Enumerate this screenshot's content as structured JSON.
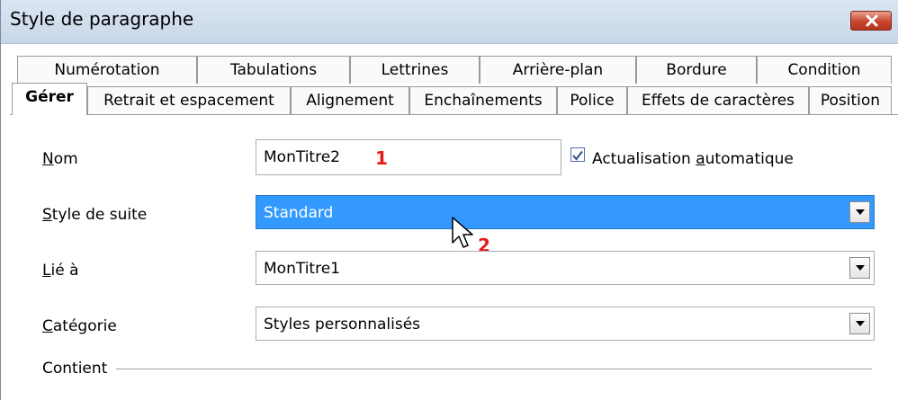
{
  "window": {
    "title": "Style de paragraphe"
  },
  "tabs_row1": [
    "Numérotation",
    "Tabulations",
    "Lettrines",
    "Arrière-plan",
    "Bordure",
    "Condition"
  ],
  "tabs_row2": [
    "Gérer",
    "Retrait et espacement",
    "Alignement",
    "Enchaînements",
    "Police",
    "Effets de caractères",
    "Position"
  ],
  "active_tab": "Gérer",
  "form": {
    "nom": {
      "label_accel": "N",
      "label_rest": "om",
      "value": "MonTitre2"
    },
    "auto_update": {
      "label_pre": "Actualisation ",
      "label_accel": "a",
      "label_post": "utomatique",
      "checked": true
    },
    "style_suite": {
      "label_accel": "S",
      "label_rest": "tyle de suite",
      "value": "Standard"
    },
    "lie_a": {
      "label_accel": "L",
      "label_rest": "ié à",
      "value": "MonTitre1"
    },
    "categorie": {
      "label_accel": "C",
      "label_rest": "atégorie",
      "value": "Styles personnalisés"
    },
    "contient": {
      "label": "Contient"
    }
  },
  "annotations": {
    "first": "1",
    "second": "2"
  },
  "colors": {
    "selection": "#3399ff",
    "annotation": "#e41b1b",
    "close": "#c8462f"
  }
}
